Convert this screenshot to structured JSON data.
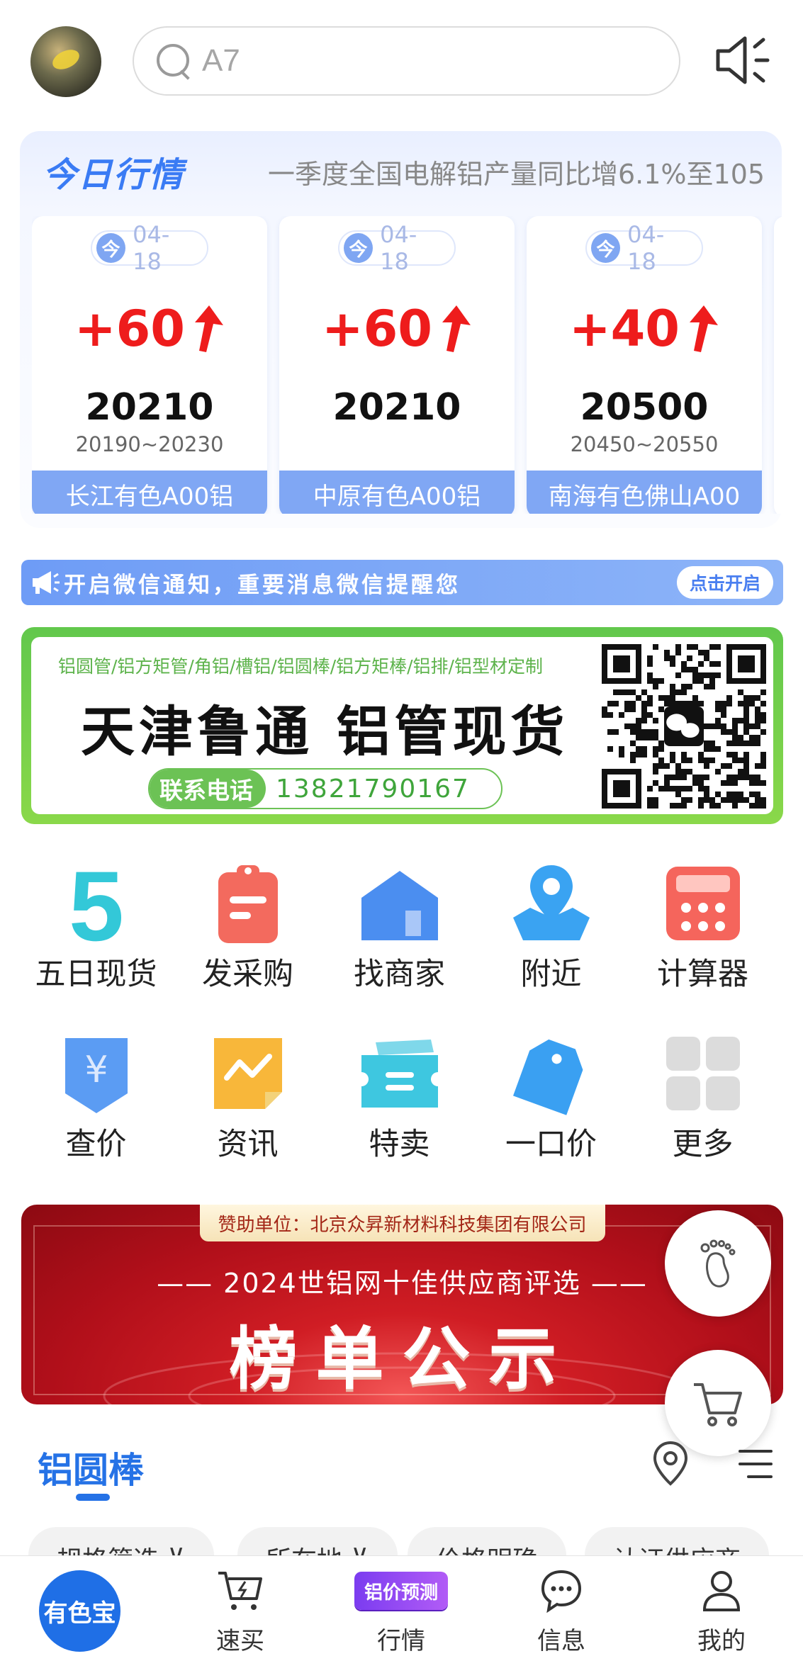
{
  "search": {
    "placeholder": "A7"
  },
  "market": {
    "title": "今日行情",
    "ticker": "一季度全国电解铝产量同比增6.1%至105",
    "cards": [
      {
        "badge": "今",
        "date": "04-18",
        "change": "+60",
        "price": "20210",
        "range": "20190~20230",
        "name": "长江有色A00铝"
      },
      {
        "badge": "今",
        "date": "04-18",
        "change": "+60",
        "price": "20210",
        "range": "",
        "name": "中原有色A00铝"
      },
      {
        "badge": "今",
        "date": "04-18",
        "change": "+40",
        "price": "20500",
        "range": "20450~20550",
        "name": "南海有色佛山A00"
      }
    ],
    "change_color": "#ee1c1c"
  },
  "notice": {
    "text": "开启微信通知，重要消息微信提醒您",
    "button": "点击开启"
  },
  "ad": {
    "subtitle": "铝圆管/铝方矩管/角铝/槽铝/铝圆棒/铝方矩棒/铝排/铝型材定制",
    "headline": "天津鲁通 铝管现货",
    "phone_label": "联系电话",
    "phone": "13821790167"
  },
  "grid": {
    "row1": [
      {
        "label": "五日现货",
        "icon": "five-icon"
      },
      {
        "label": "发采购",
        "icon": "clipboard-icon"
      },
      {
        "label": "找商家",
        "icon": "store-icon"
      },
      {
        "label": "附近",
        "icon": "map-pin-icon"
      },
      {
        "label": "计算器",
        "icon": "calculator-icon"
      }
    ],
    "row2": [
      {
        "label": "查价",
        "icon": "yen-shield-icon"
      },
      {
        "label": "资讯",
        "icon": "news-chart-icon"
      },
      {
        "label": "特卖",
        "icon": "ticket-icon"
      },
      {
        "label": "一口价",
        "icon": "price-tag-icon"
      },
      {
        "label": "更多",
        "icon": "grid-more-icon"
      }
    ]
  },
  "banner": {
    "sponsor": "赞助单位：北京众昇新材料科技集团有限公司",
    "subtitle": "—— 2024世铝网十佳供应商评选 ——",
    "headline": "榜单公示"
  },
  "section": {
    "title": "铝圆棒",
    "filters": [
      "规格筛选",
      "所在地",
      "价格明确",
      "认证供应商"
    ]
  },
  "bottom_nav": {
    "home": "有色宝",
    "items": [
      {
        "label": "速买",
        "icon": "quick-cart-icon"
      },
      {
        "label": "行情",
        "icon": "price-forecast-badge",
        "badge": "铝价预测"
      },
      {
        "label": "信息",
        "icon": "chat-icon"
      },
      {
        "label": "我的",
        "icon": "user-icon"
      }
    ]
  }
}
